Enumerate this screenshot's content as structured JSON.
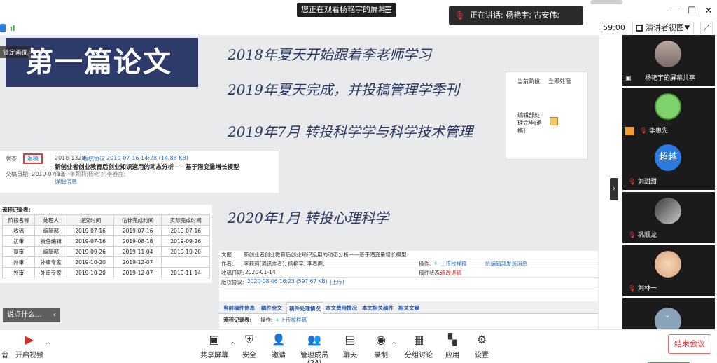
{
  "top": {
    "share_banner": "您正在观看杨艳宇的屏幕",
    "speaking": "正在讲话: 杨艳宇; 古安伟;",
    "timer": "59:00",
    "view_label": "演讲者视图",
    "signal": "ıl"
  },
  "slide": {
    "title": "第一篇论文",
    "lock_label": "锁定画面",
    "headlines": [
      "2018年夏天开始跟着李老师学习",
      "2019年夏天完成，并投稿管理学季刊",
      "2019年7月 转投科学学与科学技术管理",
      "2020年1月 转投心理科学"
    ],
    "right_box": {
      "col1": "当前阶段",
      "col2": "立即处理",
      "stage": "编辑部处理完毕[退稿]"
    },
    "paper": {
      "status_label": "状态:",
      "status_value": "退稿",
      "meta": "2018-1328",
      "accept_label": "版权协议:",
      "accept_value": "2019-07-16 14:28 (14.88 KB)",
      "title": "新创业者创业教育后创业知识运用的动态分析——基于潜变量增长模型",
      "date": "交稿日期: 2019-07-12",
      "authors": "作者: 李莉莉;杨艳宇;李春鹿;",
      "detail": "详细信息"
    },
    "flow": {
      "caption": "流程记录表:",
      "headers": [
        "阶段名称",
        "处理人",
        "提交时间",
        "估计完成时间",
        "实际完成时间"
      ],
      "rows": [
        [
          "收稿",
          "编辑部",
          "2019-07-16",
          "2019-07-16",
          "2019-07-16"
        ],
        [
          "初审",
          "责任编辑",
          "2019-07-16",
          "2019-08-18",
          "2019-09-26"
        ],
        [
          "复审",
          "编辑部",
          "2019-09-26",
          "2019-11-04",
          "2019-10-20"
        ],
        [
          "外审",
          "外审专家",
          "2019-10-20",
          "2019-12-07",
          ""
        ],
        [
          "外审",
          "外审专家",
          "2019-10-20",
          "2019-12-07",
          "2019-11-14"
        ]
      ]
    },
    "say_bar": "说点什么...",
    "manuscript": {
      "topic_label": "文题:",
      "topic": "新创业者创业教育后创业知识运用的动态分析——基于潜变量增长模型",
      "author_label": "作者:",
      "authors": "李莉莉(通讯作者); 杨艳宇; 李春鹿;",
      "ops_label": "操作:",
      "upload": "上传校样稿",
      "contact": "给编辑部发送消息",
      "received_label": "收稿日期:",
      "received": "2020-01-14",
      "status_label": "稿件状态:",
      "status": "修改退稿",
      "copyright_label": "版权协议:",
      "copyright": "2020-08-06 16:23 (597.67 KB)",
      "copyright_note": "(上传)",
      "tabs": [
        "当前稿件信息",
        "稿件全文",
        "稿件处理情况",
        "本文费用情况",
        "本文相关稿件",
        "相关文献"
      ],
      "flow_caption": "流程记录表:",
      "flow_ops": "操作:",
      "flow_upload": "上传校样稿"
    }
  },
  "participants": [
    {
      "name": "杨艳宇的屏幕共享"
    },
    {
      "name": "李惠先"
    },
    {
      "name": "刘甜甜",
      "avatar_text": "超越"
    },
    {
      "name": "巩顺龙"
    },
    {
      "name": "刘林一"
    }
  ],
  "toolbar": {
    "items": [
      {
        "label": "音",
        "icon": "audio-icon"
      },
      {
        "label": "开启视频",
        "icon": "video-off-icon"
      },
      {
        "label": "共享屏幕",
        "icon": "share-screen-icon"
      },
      {
        "label": "安全",
        "icon": "shield-icon"
      },
      {
        "label": "邀请",
        "icon": "invite-icon"
      },
      {
        "label": "管理成员(34)",
        "icon": "participants-icon"
      },
      {
        "label": "聊天",
        "icon": "chat-icon"
      },
      {
        "label": "录制",
        "icon": "record-icon"
      },
      {
        "label": "分组讨论",
        "icon": "breakout-icon"
      },
      {
        "label": "应用",
        "icon": "apps-icon"
      },
      {
        "label": "设置",
        "icon": "gear-icon"
      }
    ],
    "end_meeting": "结束会议"
  },
  "colors": {
    "title_bg": "#2d3a6a",
    "headline": "#2a3560",
    "end_red": "#d32f2f",
    "accent_green": "#2ea84a"
  }
}
